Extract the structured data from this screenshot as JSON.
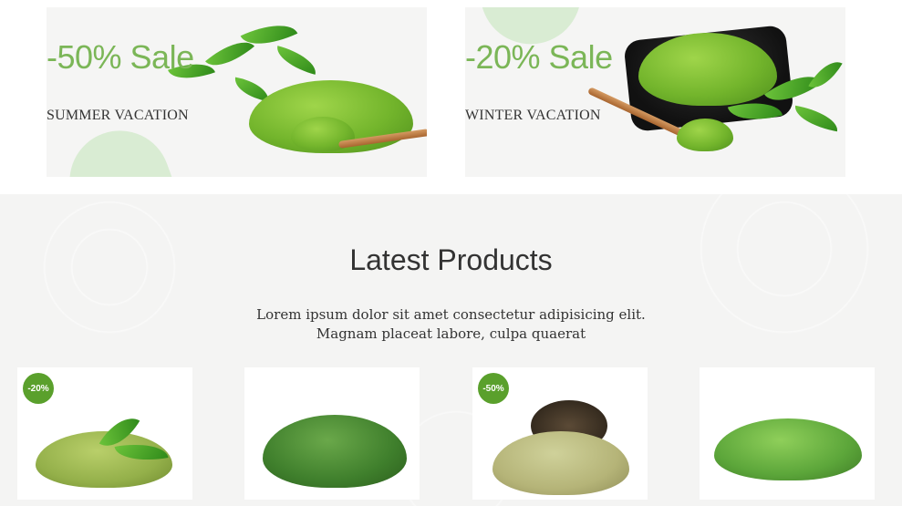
{
  "banners": [
    {
      "sale": "-50% Sale",
      "subtitle": "SUMMER VACATION"
    },
    {
      "sale": "-20% Sale",
      "subtitle": "WINTER VACATION"
    }
  ],
  "latest": {
    "title": "Latest Products",
    "description_line1": "Lorem ipsum dolor sit amet consectetur adipisicing elit.",
    "description_line2": "Magnam placeat labore, culpa quaerat"
  },
  "products": [
    {
      "badge": "-20%",
      "image": "matcha-powder-with-leaves"
    },
    {
      "badge": "",
      "image": "dried-tea-leaves-pile"
    },
    {
      "badge": "-50%",
      "image": "matcha-powder-spilled-bowl"
    },
    {
      "badge": "",
      "image": "matcha-powder-pile"
    }
  ],
  "colors": {
    "accent": "#7bb657",
    "badge": "#5aa02c",
    "section_bg": "#f4f4f3"
  }
}
